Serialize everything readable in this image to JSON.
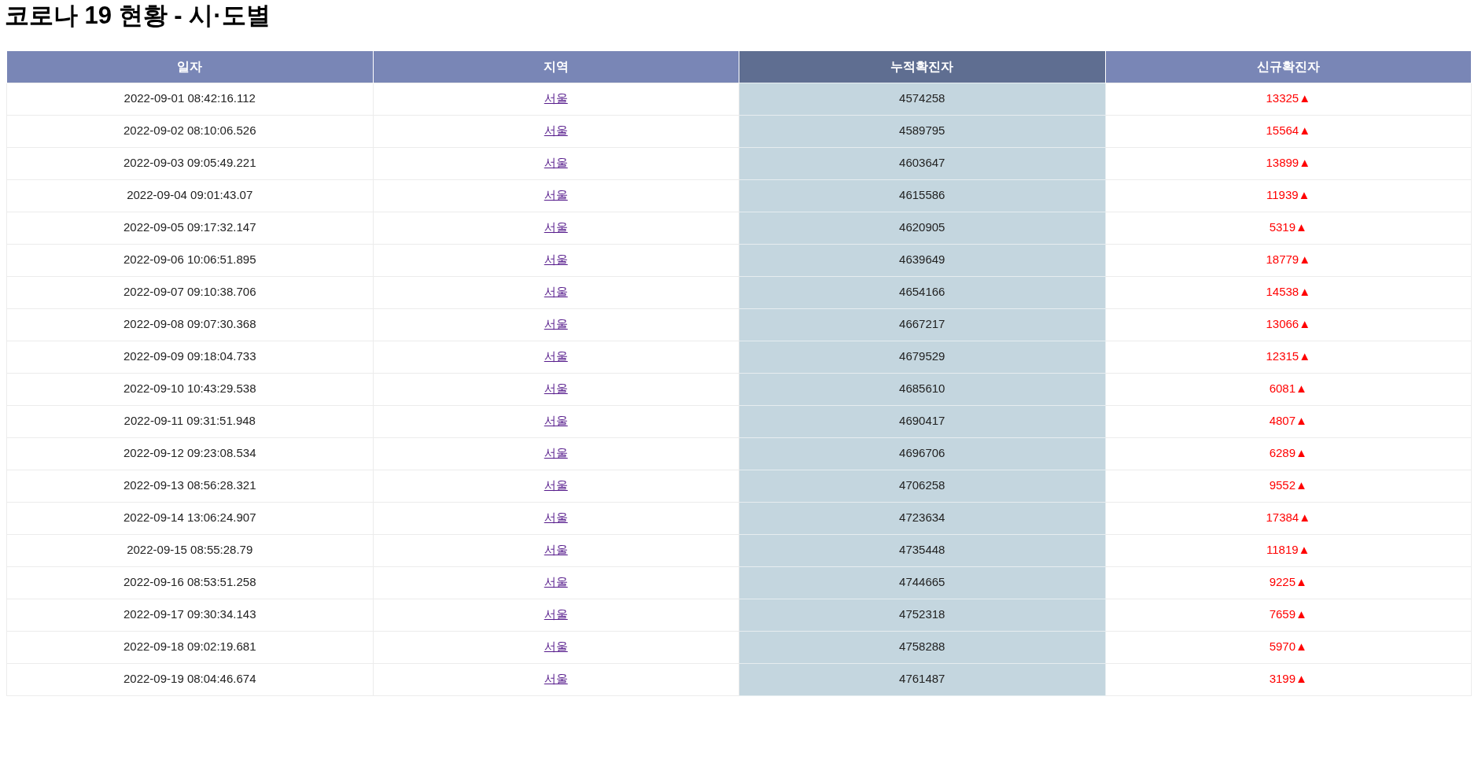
{
  "title": "코로나 19 현황 - 시·도별",
  "table": {
    "columns": [
      {
        "label": "일자",
        "selected": false
      },
      {
        "label": "지역",
        "selected": false
      },
      {
        "label": "누적확진자",
        "selected": true
      },
      {
        "label": "신규확진자",
        "selected": false
      }
    ],
    "rows": [
      {
        "date": "2022-09-01 08:42:16.112",
        "region": "서울",
        "total": "4574258",
        "new": "13325▲"
      },
      {
        "date": "2022-09-02 08:10:06.526",
        "region": "서울",
        "total": "4589795",
        "new": "15564▲"
      },
      {
        "date": "2022-09-03 09:05:49.221",
        "region": "서울",
        "total": "4603647",
        "new": "13899▲"
      },
      {
        "date": "2022-09-04 09:01:43.07",
        "region": "서울",
        "total": "4615586",
        "new": "11939▲"
      },
      {
        "date": "2022-09-05 09:17:32.147",
        "region": "서울",
        "total": "4620905",
        "new": "5319▲"
      },
      {
        "date": "2022-09-06 10:06:51.895",
        "region": "서울",
        "total": "4639649",
        "new": "18779▲"
      },
      {
        "date": "2022-09-07 09:10:38.706",
        "region": "서울",
        "total": "4654166",
        "new": "14538▲"
      },
      {
        "date": "2022-09-08 09:07:30.368",
        "region": "서울",
        "total": "4667217",
        "new": "13066▲"
      },
      {
        "date": "2022-09-09 09:18:04.733",
        "region": "서울",
        "total": "4679529",
        "new": "12315▲"
      },
      {
        "date": "2022-09-10 10:43:29.538",
        "region": "서울",
        "total": "4685610",
        "new": "6081▲"
      },
      {
        "date": "2022-09-11 09:31:51.948",
        "region": "서울",
        "total": "4690417",
        "new": "4807▲"
      },
      {
        "date": "2022-09-12 09:23:08.534",
        "region": "서울",
        "total": "4696706",
        "new": "6289▲"
      },
      {
        "date": "2022-09-13 08:56:28.321",
        "region": "서울",
        "total": "4706258",
        "new": "9552▲"
      },
      {
        "date": "2022-09-14 13:06:24.907",
        "region": "서울",
        "total": "4723634",
        "new": "17384▲"
      },
      {
        "date": "2022-09-15 08:55:28.79",
        "region": "서울",
        "total": "4735448",
        "new": "11819▲"
      },
      {
        "date": "2022-09-16 08:53:51.258",
        "region": "서울",
        "total": "4744665",
        "new": "9225▲"
      },
      {
        "date": "2022-09-17 09:30:34.143",
        "region": "서울",
        "total": "4752318",
        "new": "7659▲"
      },
      {
        "date": "2022-09-18 09:02:19.681",
        "region": "서울",
        "total": "4758288",
        "new": "5970▲"
      },
      {
        "date": "2022-09-19 08:04:46.674",
        "region": "서울",
        "total": "4761487",
        "new": "3199▲"
      }
    ]
  }
}
